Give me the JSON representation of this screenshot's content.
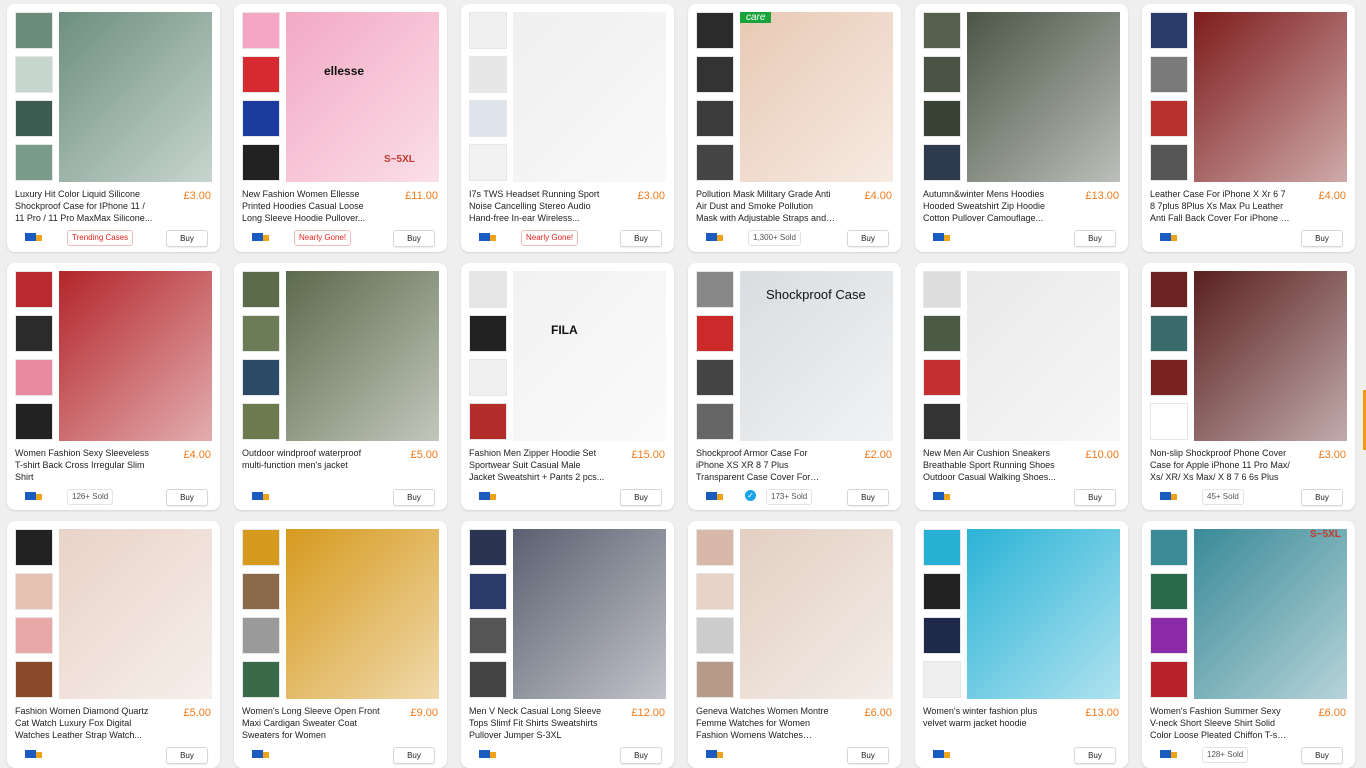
{
  "products": [
    {
      "title": "Luxury Hit Color Liquid Silicone Shockproof Case for IPhone 11 / 11 Pro / 11 Pro MaxMax Silicone...",
      "price": "£3.00",
      "badge": "Trending Cases",
      "badge_style": "red",
      "buy": "Buy",
      "main_color": "#6d8f7f",
      "thumb_colors": [
        "#6b8c7a",
        "#c6d6cf",
        "#3c5c52",
        "#7a9a8a"
      ],
      "icon": "phone-case"
    },
    {
      "title": "New Fashion Women Ellesse Printed Hoodies Casual Loose Long Sleeve Hoodie Pullover...",
      "price": "£11.00",
      "badge": "Nearly Gone!",
      "badge_style": "red",
      "buy": "Buy",
      "main_color": "#f3a9c4",
      "thumb_colors": [
        "#f5a6c4",
        "#d52a2f",
        "#1b3c9e",
        "#222222"
      ],
      "overlay": "ellesse",
      "overlay2": "S~5XL",
      "icon": "hoodie"
    },
    {
      "title": "I7s TWS Headset Running Sport Noise Cancelling Stereo Audio Hand-free In-ear Wireless...",
      "price": "£3.00",
      "badge": "Nearly Gone!",
      "badge_style": "red",
      "buy": "Buy",
      "main_color": "#efefef",
      "thumb_colors": [
        "#f0f0f0",
        "#e7e7e7",
        "#dfe3ee",
        "#f2f2f2"
      ],
      "icon": "earbuds"
    },
    {
      "title": "Pollution Mask Military Grade Anti Air Dust and Smoke Pollution Mask with Adjustable Straps and a...",
      "price": "£4.00",
      "badge": "1,300+ Sold",
      "badge_style": "",
      "buy": "Buy",
      "main_color": "#e8c9b4",
      "thumb_colors": [
        "#2b2b2b",
        "#333333",
        "#3b3b3b",
        "#444444"
      ],
      "green_tag": "care",
      "icon": "mask"
    },
    {
      "title": "Autumn&winter Mens Hoodies Hooded Sweatshirt Zip Hoodie Cotton Pullover Camouflage...",
      "price": "£13.00",
      "badge": "",
      "badge_style": "",
      "buy": "Buy",
      "main_color": "#4b5545",
      "thumb_colors": [
        "#56604e",
        "#4a5444",
        "#3a4236",
        "#2e3a4e"
      ],
      "icon": "camo-hoodie"
    },
    {
      "title": "Leather Case For iPhone X Xr 6 7 8 7plus 8Plus Xs Max Pu Leather Anti Fall Back Cover For iPhone 11 Pro...",
      "price": "£4.00",
      "badge": "",
      "badge_style": "",
      "buy": "Buy",
      "main_color": "#7e1c1c",
      "thumb_colors": [
        "#2a3b6b",
        "#7a7a7a",
        "#b8312c",
        "#555555"
      ],
      "icon": "leather-case"
    },
    {
      "title": "Women Fashion Sexy Sleeveless T-shirt Back Cross Irregular Slim Shirt",
      "price": "£4.00",
      "badge": "126+ Sold",
      "badge_style": "",
      "buy": "Buy",
      "main_color": "#b3252a",
      "thumb_colors": [
        "#b82a30",
        "#2b2b2b",
        "#e88aa0",
        "#222222"
      ],
      "icon": "top"
    },
    {
      "title": "Outdoor windproof waterproof multi-function men's jacket",
      "price": "£5.00",
      "badge": "",
      "badge_style": "",
      "buy": "Buy",
      "main_color": "#5c6a4c",
      "thumb_colors": [
        "#5b6a48",
        "#6b7c57",
        "#2c4a66",
        "#6b7a4f"
      ],
      "icon": "jacket"
    },
    {
      "title": "Fashion Men Zipper Hoodie Set Sportwear Suit Casual Male Jacket Sweatshirt + Pants 2 pcs...",
      "price": "£15.00",
      "badge": "",
      "badge_style": "",
      "buy": "Buy",
      "main_color": "#f2f2f2",
      "thumb_colors": [
        "#e6e6e6",
        "#222222",
        "#f0f0f0",
        "#b32c2c"
      ],
      "overlay": "FILA",
      "icon": "tracksuit"
    },
    {
      "title": "Shockproof Armor Case For iPhone XS XR 8 7 Plus Transparent Case Cover For iPhone 6 6S Plus 5 XS...",
      "price": "£2.00",
      "badge": "173+ Sold",
      "badge_style": "",
      "verified": true,
      "buy": "Buy",
      "main_color": "#d9dde0",
      "thumb_colors": [
        "#888888",
        "#cc2a2a",
        "#444444",
        "#666666"
      ],
      "case_label": "Shockproof Case",
      "icon": "armor-case"
    },
    {
      "title": "New Men Air Cushion Sneakers Breathable Sport Running Shoes Outdoor Casual Walking Shoes...",
      "price": "£10.00",
      "badge": "",
      "badge_style": "",
      "buy": "Buy",
      "main_color": "#e9e9e9",
      "thumb_colors": [
        "#dddddd",
        "#4b5a45",
        "#c23030",
        "#333333"
      ],
      "icon": "sneaker"
    },
    {
      "title": "Non-slip Shockproof Phone Cover Case for Apple iPhone 11 Pro Max/ Xs/ XR/ Xs Max/ X 8 7 6 6s Plus",
      "price": "£3.00",
      "badge": "45+ Sold",
      "badge_style": "",
      "buy": "Buy",
      "main_color": "#5a1f1f",
      "thumb_colors": [
        "#6b2222",
        "#3a6b6b",
        "#7a2222",
        "#ffffff"
      ],
      "icon": "phone-case"
    },
    {
      "title": "Fashion Women Diamond Quartz Cat Watch Luxury Fox Digital Watches Leather Strap Watch...",
      "price": "£5.00",
      "badge": "",
      "badge_style": "",
      "buy": "Buy",
      "main_color": "#e8d3c8",
      "thumb_colors": [
        "#222222",
        "#e7c2b3",
        "#e8a8a8",
        "#8a4a2a"
      ],
      "icon": "watch"
    },
    {
      "title": "Women's Long Sleeve Open Front Maxi Cardigan Sweater Coat Sweaters for Women",
      "price": "£9.00",
      "badge": "",
      "badge_style": "",
      "buy": "Buy",
      "main_color": "#d69a1e",
      "thumb_colors": [
        "#d69a1e",
        "#8a6a4a",
        "#9a9a9a",
        "#3a6a4a"
      ],
      "icon": "cardigan"
    },
    {
      "title": "Men V Neck Casual Long Sleeve Tops Slimf Fit Shirts Sweatshirts Pullover Jumper S-3XL",
      "price": "£12.00",
      "badge": "",
      "badge_style": "",
      "buy": "Buy",
      "main_color": "#5a6070",
      "thumb_colors": [
        "#2a3450",
        "#2a3a6a",
        "#555555",
        "#444444"
      ],
      "icon": "sweater"
    },
    {
      "title": "Geneva Watches Women Montre Femme Watches for Women Fashion Womens Watches Ladies...",
      "price": "£6.00",
      "badge": "",
      "badge_style": "",
      "buy": "Buy",
      "main_color": "#e2cfc2",
      "thumb_colors": [
        "#d8b8a8",
        "#e8d3c8",
        "#cccccc",
        "#b89a88"
      ],
      "icon": "watch"
    },
    {
      "title": "Women's winter fashion plus velvet warm jacket hoodie",
      "price": "£13.00",
      "badge": "",
      "badge_style": "",
      "buy": "Buy",
      "main_color": "#2bb3d6",
      "thumb_colors": [
        "#28b0d4",
        "#222222",
        "#1f2a4a",
        "#eeeeee"
      ],
      "icon": "hoodie"
    },
    {
      "title": "Women's Fashion Summer Sexy V-neck Short Sleeve Shirt Solid Color Loose Pleated Chiffon T-shirt Top...",
      "price": "£6.00",
      "badge": "128+ Sold",
      "badge_style": "",
      "buy": "Buy",
      "main_color": "#3a8a98",
      "thumb_colors": [
        "#3a8a98",
        "#2a6a4a",
        "#8a2aa8",
        "#b8202a"
      ],
      "overlay2": "S~5XL",
      "icon": "blouse"
    }
  ]
}
